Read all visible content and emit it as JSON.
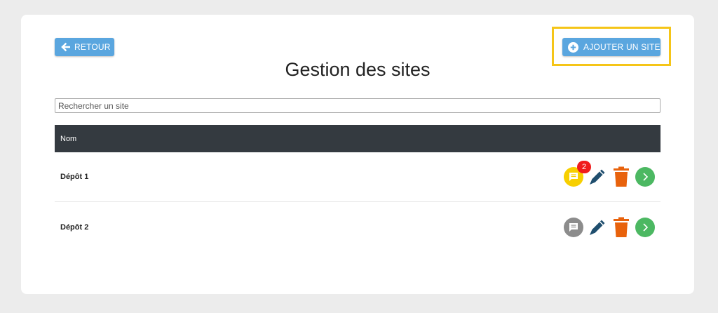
{
  "header": {
    "back_label": "RETOUR",
    "add_label": "AJOUTER UN SITE",
    "title": "Gestion des sites"
  },
  "search": {
    "placeholder": "Rechercher un site",
    "value": ""
  },
  "table": {
    "columns": [
      "Nom"
    ],
    "rows": [
      {
        "name": "Dépôt 1",
        "comment_count": "2",
        "comment_color": "#f7cf00"
      },
      {
        "name": "Dépôt 2",
        "comment_count": "",
        "comment_color": "#8c8c8c"
      }
    ]
  },
  "colors": {
    "button": "#5aa6df",
    "table_header": "#343a40",
    "edit": "#1f4e6e",
    "delete": "#e8620c",
    "go": "#4cb862",
    "badge": "#f01c1c",
    "highlight": "#f5c518"
  },
  "icons": {
    "back": "arrow-left-icon",
    "add": "plus-circle-icon",
    "comment": "comment-icon",
    "edit": "pencil-icon",
    "delete": "trash-icon",
    "go": "chevron-right-icon"
  }
}
